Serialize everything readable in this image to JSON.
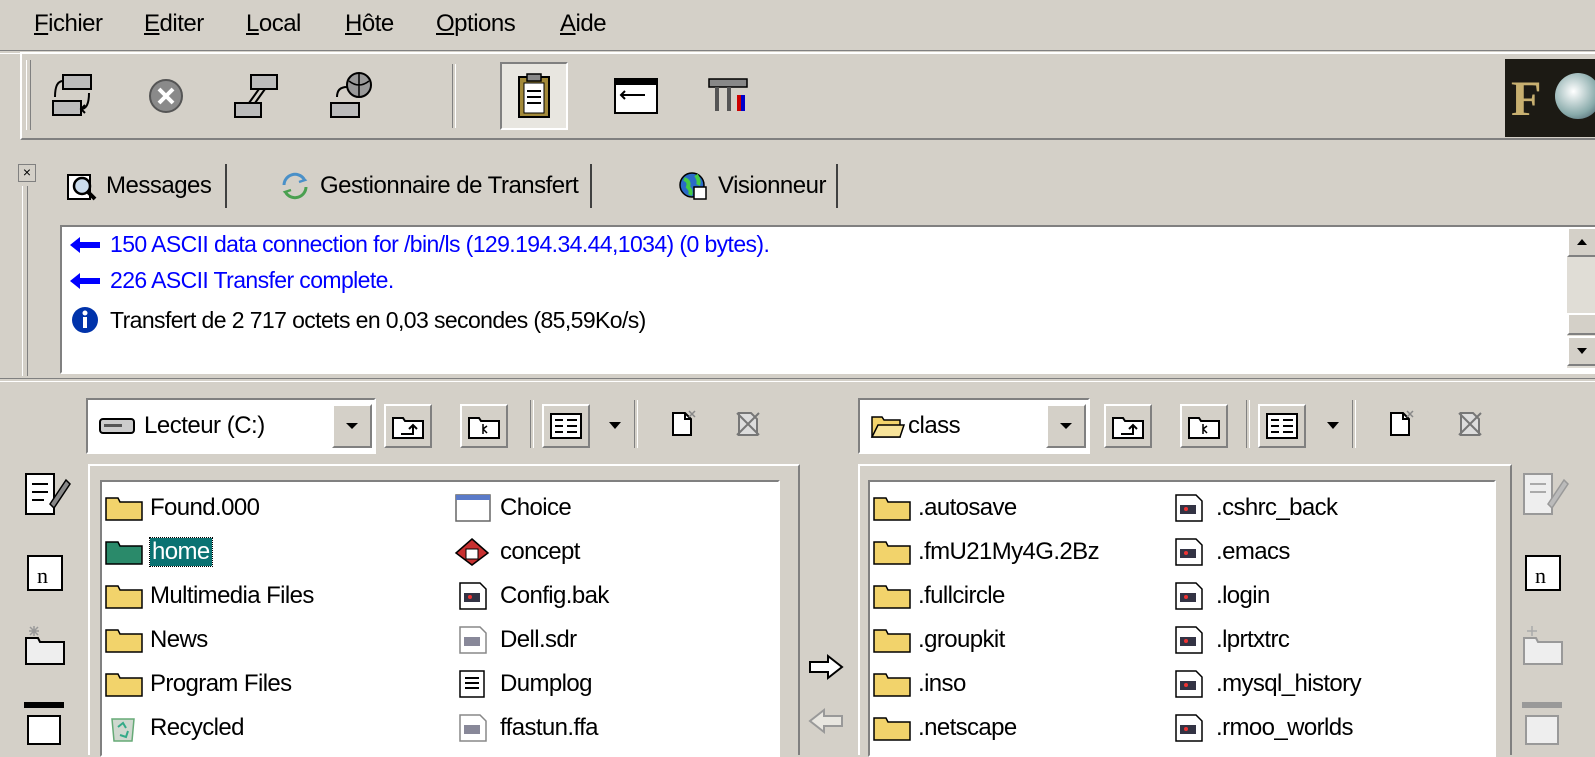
{
  "menu": [
    {
      "hotkey": "F",
      "rest": "ichier"
    },
    {
      "hotkey": "E",
      "rest": "diter"
    },
    {
      "hotkey": "L",
      "rest": "ocal"
    },
    {
      "hotkey": "H",
      "rest": "ôte"
    },
    {
      "hotkey": "O",
      "rest": "ptions"
    },
    {
      "hotkey": "A",
      "rest": "ide"
    }
  ],
  "toolbar": {
    "icons": [
      "connect-icon",
      "stop-icon",
      "disconnect-icon",
      "reconnect-icon",
      "log-view-icon",
      "window-icon",
      "tools-icon"
    ],
    "logo_text": "F"
  },
  "tabs": [
    {
      "label": "Messages",
      "icon": "magnifier-icon"
    },
    {
      "label": "Gestionnaire de Transfert",
      "icon": "transfer-icon"
    },
    {
      "label": "Visionneur",
      "icon": "globe-icon"
    }
  ],
  "log": [
    {
      "text": "150 ASCII data connection for /bin/ls (129.194.34.44,1034) (0 bytes).",
      "kind": "server",
      "color": "#0000ff"
    },
    {
      "text": "226 ASCII Transfer complete.",
      "kind": "server",
      "color": "#0000ff"
    },
    {
      "text": "Transfert de 2 717 octets en 0,03 secondes (85,59Ko/s)",
      "kind": "info",
      "color": "#000000"
    }
  ],
  "local": {
    "location": "Lecteur (C:)",
    "col1": [
      {
        "name": "Found.000",
        "icon": "folder-icon"
      },
      {
        "name": "home",
        "icon": "folder-icon",
        "selected": true
      },
      {
        "name": "Multimedia Files",
        "icon": "folder-icon"
      },
      {
        "name": "News",
        "icon": "folder-icon"
      },
      {
        "name": "Program Files",
        "icon": "folder-icon"
      },
      {
        "name": "Recycled",
        "icon": "recycle-icon"
      }
    ],
    "col2": [
      {
        "name": "Choice",
        "icon": "window-file-icon"
      },
      {
        "name": "concept",
        "icon": "concept-icon"
      },
      {
        "name": "Config.bak",
        "icon": "file-icon"
      },
      {
        "name": "Dell.sdr",
        "icon": "file-icon"
      },
      {
        "name": "Dumplog",
        "icon": "text-file-icon"
      },
      {
        "name": "ffastun.ffa",
        "icon": "file-icon"
      }
    ]
  },
  "remote": {
    "location": "class",
    "col1": [
      {
        "name": ".autosave",
        "icon": "folder-icon"
      },
      {
        "name": ".fmU21My4G.2Bz",
        "icon": "folder-icon"
      },
      {
        "name": ".fullcircle",
        "icon": "folder-icon"
      },
      {
        "name": ".groupkit",
        "icon": "folder-icon"
      },
      {
        "name": ".inso",
        "icon": "folder-icon"
      },
      {
        "name": ".netscape",
        "icon": "folder-icon"
      }
    ],
    "col2": [
      {
        "name": ".cshrc_back",
        "icon": "file-icon"
      },
      {
        "name": ".emacs",
        "icon": "file-icon"
      },
      {
        "name": ".login",
        "icon": "file-icon"
      },
      {
        "name": ".lprtxtrc",
        "icon": "file-icon"
      },
      {
        "name": ".mysql_history",
        "icon": "file-icon"
      },
      {
        "name": ".rmoo_worlds",
        "icon": "file-icon"
      }
    ]
  },
  "colors": {
    "face": "#d4d0c8",
    "selection": "#0a7272",
    "log_blue": "#0000ff",
    "folder": "#f2d36b"
  }
}
